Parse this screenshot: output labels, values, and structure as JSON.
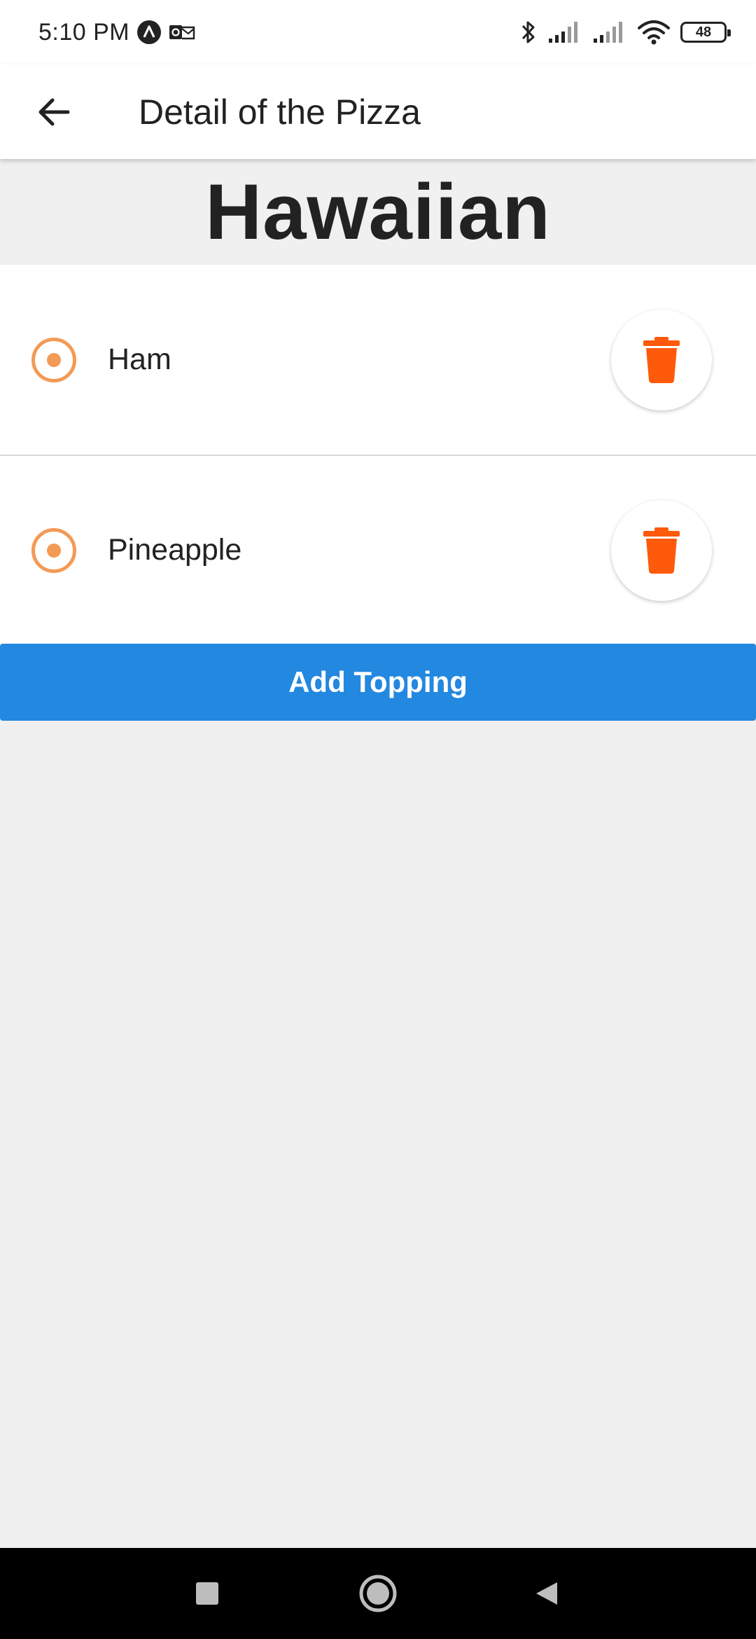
{
  "status_bar": {
    "time": "5:10 PM",
    "battery": "48",
    "icons": [
      "app-a-icon",
      "outlook-icon",
      "bluetooth-icon",
      "signal-icon",
      "signal-icon",
      "wifi-icon",
      "battery-icon"
    ]
  },
  "app_bar": {
    "title": "Detail of the Pizza",
    "back_icon": "arrow-left-icon"
  },
  "pizza": {
    "name": "Hawaiian"
  },
  "toppings": [
    {
      "label": "Ham"
    },
    {
      "label": "Pineapple"
    }
  ],
  "actions": {
    "add_topping": "Add Topping"
  },
  "colors": {
    "accent_orange": "#f39a55",
    "delete_orange": "#fe5a0b",
    "primary_blue": "#2388df"
  },
  "nav_bar": {
    "icons": [
      "recents-square-icon",
      "home-circle-icon",
      "back-triangle-icon"
    ]
  }
}
